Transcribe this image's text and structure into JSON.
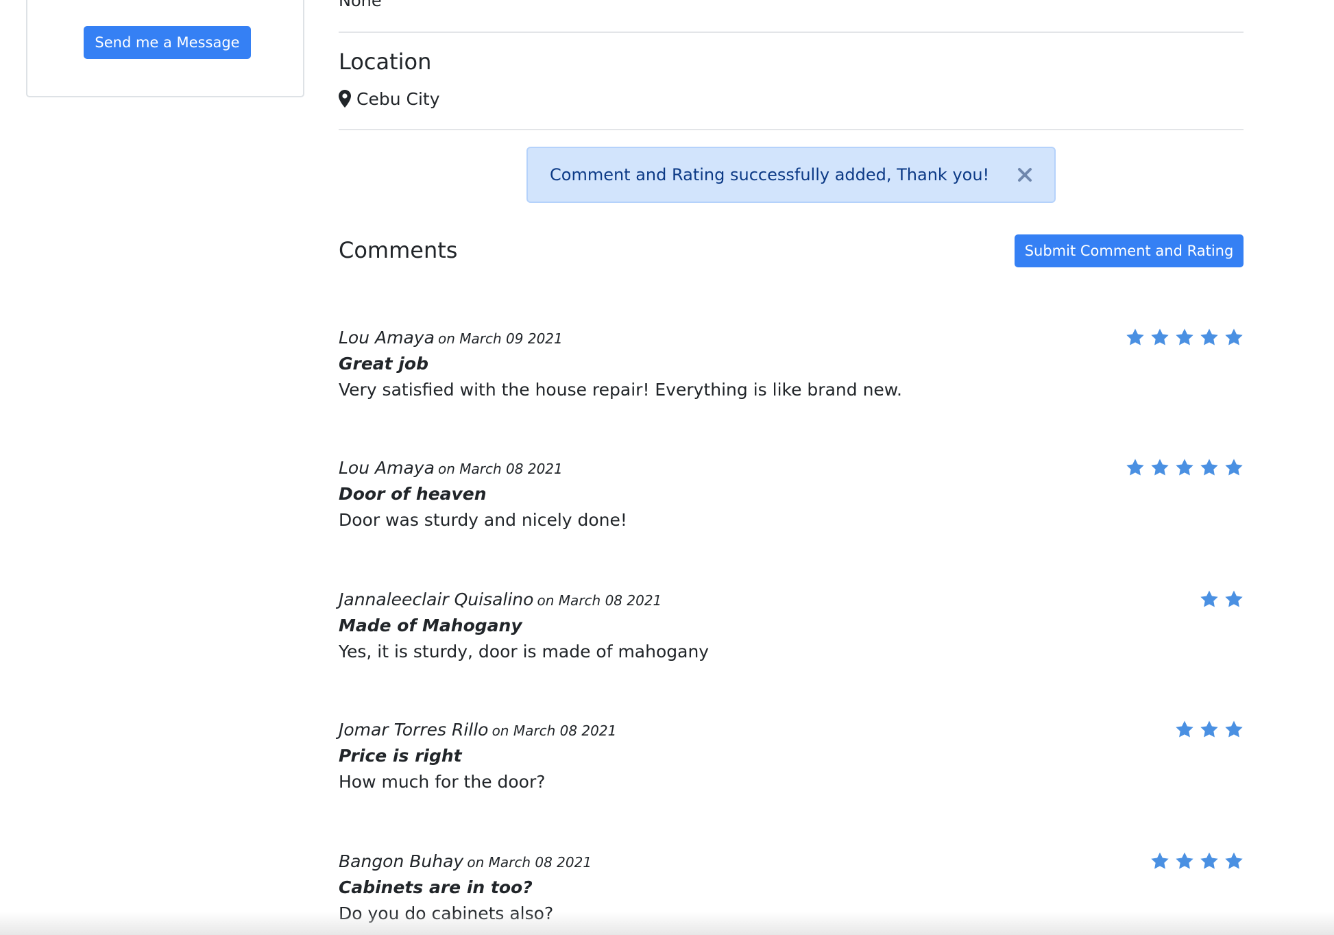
{
  "sidebar": {
    "send_message_label": "Send me a Message"
  },
  "profile": {
    "previous_value": "None",
    "location_heading": "Location",
    "location_value": "Cebu City",
    "location_icon": "map-pin-icon"
  },
  "alert": {
    "message": "Comment and Rating successfully added, Thank you!",
    "close_icon": "close-icon"
  },
  "comments_section": {
    "heading": "Comments",
    "submit_label": "Submit Comment and Rating",
    "star_color": "#4a90e2",
    "items": [
      {
        "author": "Lou Amaya",
        "date": "on March 09 2021",
        "title": "Great job",
        "body": "Very satisfied with the house repair! Everything is like brand new.",
        "rating": 5
      },
      {
        "author": "Lou Amaya",
        "date": "on March 08 2021",
        "title": "Door of heaven",
        "body": "Door was sturdy and nicely done!",
        "rating": 5
      },
      {
        "author": "Jannaleeclair Quisalino",
        "date": "on March 08 2021",
        "title": "Made of Mahogany",
        "body": "Yes, it is sturdy, door is made of mahogany",
        "rating": 2
      },
      {
        "author": "Jomar Torres Rillo",
        "date": "on March 08 2021",
        "title": "Price is right",
        "body": "How much for the door?",
        "rating": 3
      },
      {
        "author": "Bangon Buhay",
        "date": "on March 08 2021",
        "title": "Cabinets are in too?",
        "body": "Do you do cabinets also?",
        "rating": 4
      }
    ]
  }
}
